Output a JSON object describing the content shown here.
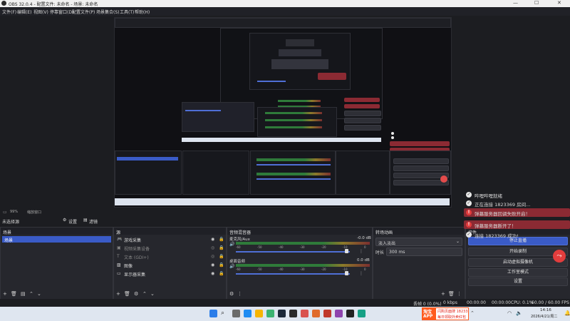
{
  "window": {
    "title": "OBS 32.0.4 - 配置文件: 未命名 - 场景: 未命名",
    "minimize": "—",
    "maximize": "☐",
    "close": "✕"
  },
  "menu": [
    "文件(F)",
    "编辑(E)",
    "视图(V)",
    "停靠窗口(D)",
    "配置文件(P)",
    "场景集合(S)",
    "工具(T)",
    "帮助(H)"
  ],
  "zoom": {
    "value": "99%",
    "label": "缩放窗口"
  },
  "scene_status": {
    "label": "未选择源",
    "settings": "设置",
    "filters": "滤镜"
  },
  "docks": {
    "scenes": {
      "title": "场景",
      "items": [
        "场景"
      ]
    },
    "sources": {
      "title": "源",
      "items": [
        {
          "label": "游戏采集",
          "visible": true
        },
        {
          "label": "视频采集设备",
          "visible": false
        },
        {
          "label": "文本 (GDI+)",
          "visible": false
        },
        {
          "label": "图像",
          "visible": true
        },
        {
          "label": "显示器采集",
          "visible": true
        }
      ]
    },
    "mixer": {
      "title": "音频混音器",
      "channels": [
        {
          "name": "麦克风/Aux",
          "db": "-0.0 dB",
          "scale": [
            "-60",
            "-55",
            "-50",
            "-45",
            "-40",
            "-35",
            "-30",
            "-25",
            "-20",
            "-15",
            "-10",
            "-5",
            "0"
          ]
        },
        {
          "name": "桌面音频",
          "db": "0.0 dB",
          "scale": [
            "-60",
            "-55",
            "-50",
            "-45",
            "-40",
            "-35",
            "-30",
            "-25",
            "-20",
            "-15",
            "-10",
            "-5",
            "0"
          ]
        }
      ]
    },
    "transitions": {
      "title": "转场动画",
      "type": "淡入淡出",
      "duration_label": "时长",
      "duration": "300 ms"
    },
    "controls": {
      "title": "控件",
      "buttons": [
        "停止直播",
        "开始录制",
        "启动虚拟摄像机",
        "工作室模式",
        "设置"
      ]
    }
  },
  "notifications": [
    {
      "type": "info",
      "text": "哔哩哔哩就绪"
    },
    {
      "type": "info",
      "text": "正在连接 1823369 房间..."
    },
    {
      "type": "error",
      "text": "弹幕服务器回调失败开启！"
    },
    {
      "type": "error",
      "text": "弹幕服务器断开了！"
    },
    {
      "type": "info",
      "text": "连接 1823369 成功!"
    }
  ],
  "status": {
    "frames": "丢帧 0 (0.0%)",
    "kbps": "0 kbps",
    "live_time": "00:00:00",
    "rec_time": "00:00:00",
    "cpu": "CPU: 0.1%",
    "fps": "60.00 / 60.00 FPS"
  },
  "taskbar": {
    "ad_brand_top": "淘宝",
    "ad_brand_bottom": "APP",
    "ad_line1": "闪购页面搜 18233",
    "ad_line2": "每日领取外卖红包",
    "time": "14:16",
    "date": "2026/4/21/周二"
  },
  "colors": {
    "accent": "#4f6fd6",
    "error": "#8b2a33",
    "info": "#ffffff"
  }
}
